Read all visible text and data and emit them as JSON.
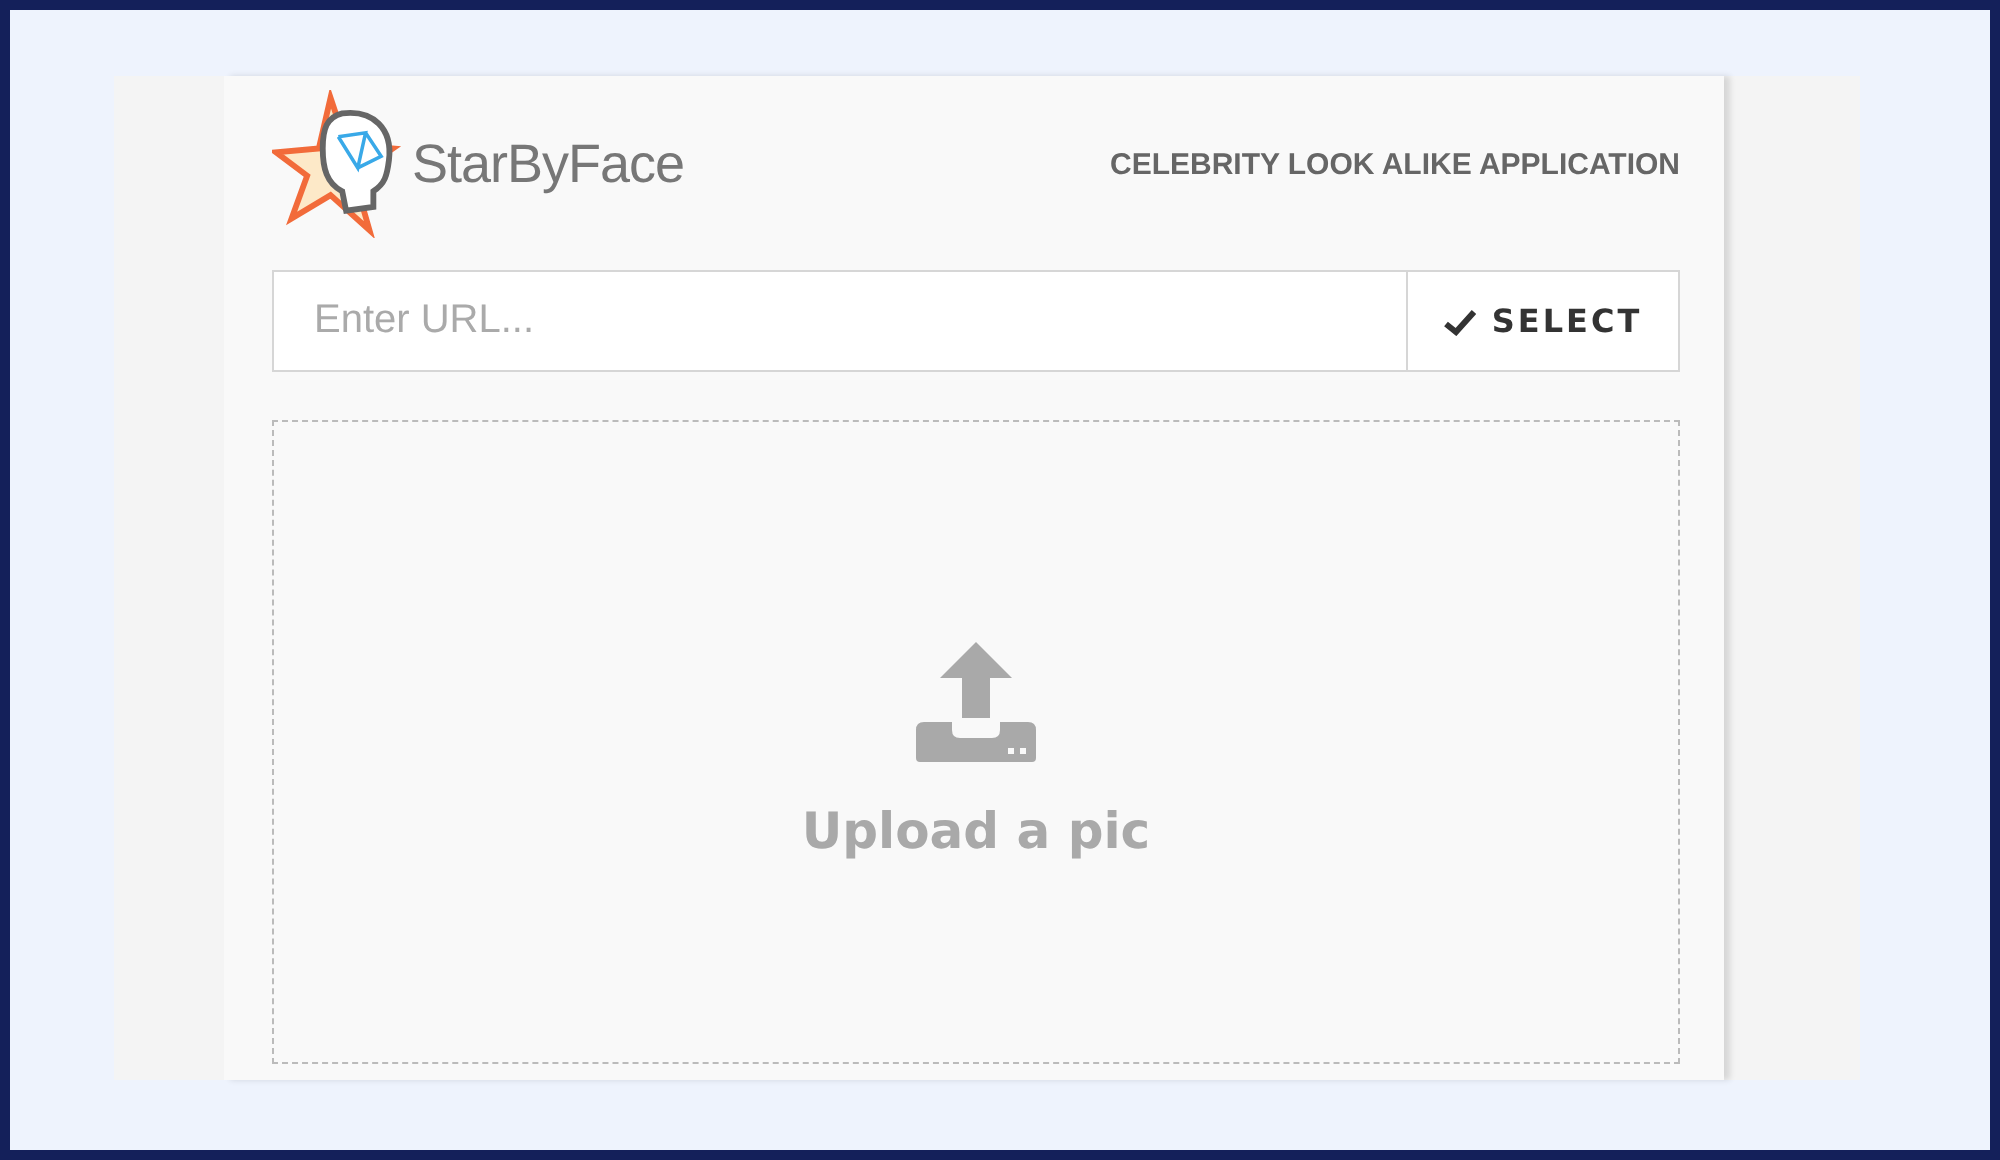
{
  "header": {
    "brand": "StarByFace",
    "tagline": "CELEBRITY LOOK ALIKE APPLICATION"
  },
  "url_field": {
    "placeholder": "Enter URL..."
  },
  "select_button": {
    "label": "SELECT"
  },
  "dropzone": {
    "label": "Upload a pic"
  }
}
